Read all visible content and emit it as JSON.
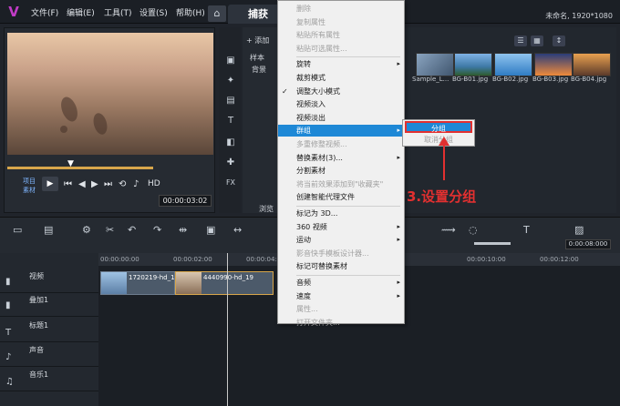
{
  "app": {
    "logo": "V",
    "menu": [
      "文件(F)",
      "编辑(E)",
      "工具(T)",
      "设置(S)",
      "帮助(H)"
    ],
    "tab_capture": "捕获",
    "project": "未命名, 1920*1080",
    "home_icon": "home-icon"
  },
  "player": {
    "mode_project": "项目",
    "mode_clip": "素材",
    "hd": "HD",
    "timecode": "00:00:03:02"
  },
  "library": {
    "add_label": "添加",
    "sample_label": "样本",
    "background_label": "背景",
    "browse_label": "浏览",
    "thumbs": [
      "Sample_L...",
      "BG-B01.jpg",
      "BG-B02.jpg",
      "BG-B03.jpg",
      "BG-B04.jpg"
    ]
  },
  "timeline": {
    "timecode": "0:00:08:000",
    "ruler": [
      "00:00:00:00",
      "00:00:02:00",
      "00:00:04:",
      "00:00:10:00",
      "00:00:12:00"
    ],
    "tracks": [
      "视频",
      "叠加1",
      "标题1",
      "声音",
      "音乐1"
    ],
    "clips": [
      "1720219-hd_19",
      "4440990-hd_19"
    ]
  },
  "context_menu": {
    "items": [
      {
        "label": "删除",
        "state": "disabled",
        "arrow": false
      },
      {
        "label": "复制属性",
        "state": "disabled",
        "arrow": false
      },
      {
        "label": "粘贴所有属性",
        "state": "disabled",
        "arrow": false
      },
      {
        "label": "粘贴可选属性...",
        "state": "disabled",
        "arrow": false
      },
      {
        "label": "旋转",
        "state": "normal",
        "arrow": true
      },
      {
        "label": "裁剪模式",
        "state": "normal",
        "arrow": false
      },
      {
        "label": "调整大小模式",
        "state": "normal",
        "arrow": false,
        "checked": true
      },
      {
        "label": "视频淡入",
        "state": "normal",
        "arrow": false
      },
      {
        "label": "视频淡出",
        "state": "normal",
        "arrow": false
      },
      {
        "label": "群组",
        "state": "active",
        "arrow": true
      },
      {
        "label": "多重修整视频...",
        "state": "disabled",
        "arrow": false
      },
      {
        "label": "替换素材(3)...",
        "state": "normal",
        "arrow": true
      },
      {
        "label": "分割素材",
        "state": "normal",
        "arrow": false
      },
      {
        "label": "将当前效果添加到\"收藏夹\"",
        "state": "disabled",
        "arrow": false
      },
      {
        "label": "创建智能代理文件",
        "state": "normal",
        "arrow": false
      },
      {
        "label": "标记为 3D...",
        "state": "normal",
        "arrow": false
      },
      {
        "label": "360 视频",
        "state": "normal",
        "arrow": true
      },
      {
        "label": "运动",
        "state": "normal",
        "arrow": true
      },
      {
        "label": "影音快手模板设计器...",
        "state": "disabled",
        "arrow": false
      },
      {
        "label": "标记可替换素材",
        "state": "normal",
        "arrow": false
      },
      {
        "label": "音频",
        "state": "normal",
        "arrow": true
      },
      {
        "label": "速度",
        "state": "normal",
        "arrow": true
      },
      {
        "label": "属性...",
        "state": "disabled",
        "arrow": false
      },
      {
        "label": "打开文件夹...",
        "state": "disabled",
        "arrow": false
      }
    ],
    "checkmark": "✓",
    "arrow_glyph": "▸"
  },
  "submenu": {
    "group": "分组",
    "ungroup": "取消分组"
  },
  "annotation": {
    "text": "3.设置分组",
    "color": "#e23030"
  }
}
